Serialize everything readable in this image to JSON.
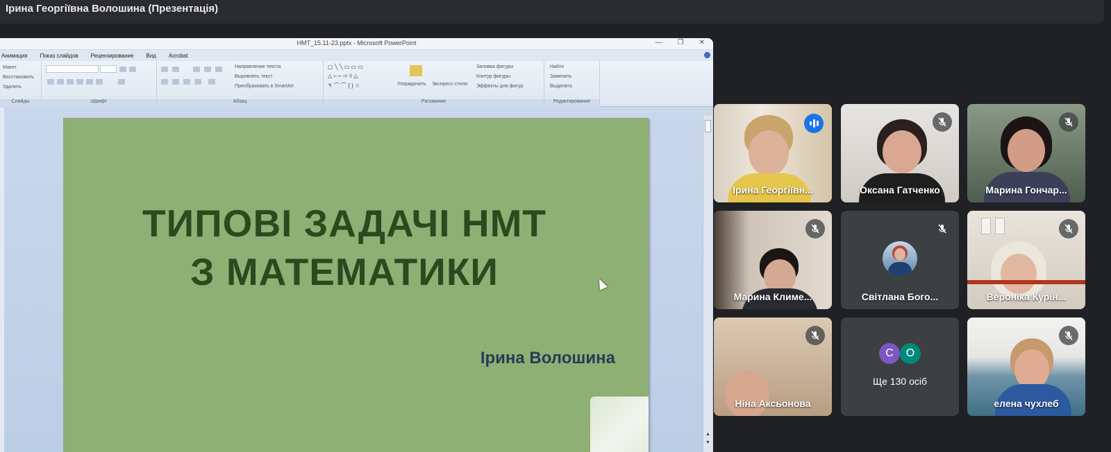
{
  "meeting": {
    "presenter_title": "Ірина Георгіївна Волошина (Презентація)"
  },
  "powerpoint": {
    "window_title": "НМТ_15.11-23.pptx - Microsoft PowerPoint",
    "window_buttons": [
      "—",
      "❐",
      "✕"
    ],
    "menu": [
      "Анимация",
      "Показ слайдов",
      "Рецензирование",
      "Вид",
      "Acrobat"
    ],
    "ribbon": {
      "slides_items": [
        "Макет",
        "Восстановить",
        "Удалить"
      ],
      "slides_label": "Слайды",
      "font_label": "Шрифт",
      "paragraph_items": [
        "Направление текста",
        "Выровнять текст",
        "Преобразовать в SmartArt"
      ],
      "paragraph_label": "Абзац",
      "drawing_items": [
        "Упорядочить",
        "Экспресс-стили",
        "Заливка фигуры",
        "Контур фигуры",
        "Эффекты для фигур"
      ],
      "drawing_label": "Рисование",
      "editing_items": [
        "Найти",
        "Заменить",
        "Выделить"
      ],
      "editing_label": "Редактирование"
    }
  },
  "slide": {
    "title_line1": "ТИПОВІ ЗАДАЧІ НМТ",
    "title_line2": "З МАТЕМАТИКИ",
    "author": "Ірина Волошина",
    "background_color": "#8eb074"
  },
  "participants": [
    {
      "name": "Ірина Георгіївн...",
      "speaking": true,
      "muted": false
    },
    {
      "name": "Оксана Гатченко",
      "speaking": false,
      "muted": true
    },
    {
      "name": "Марина Гончар...",
      "speaking": false,
      "muted": true
    },
    {
      "name": "Марина Климе...",
      "speaking": false,
      "muted": true
    },
    {
      "name": "Світлана Бого...",
      "speaking": false,
      "muted": true
    },
    {
      "name": "Вероніка Курін...",
      "speaking": false,
      "muted": true
    },
    {
      "name": "Ніна Аксьонова",
      "speaking": false,
      "muted": true
    },
    {
      "name": "елена чухлеб",
      "speaking": false,
      "muted": true
    }
  ],
  "others": {
    "avatar1": "С",
    "avatar2": "О",
    "label": "Ще 130 осіб"
  }
}
